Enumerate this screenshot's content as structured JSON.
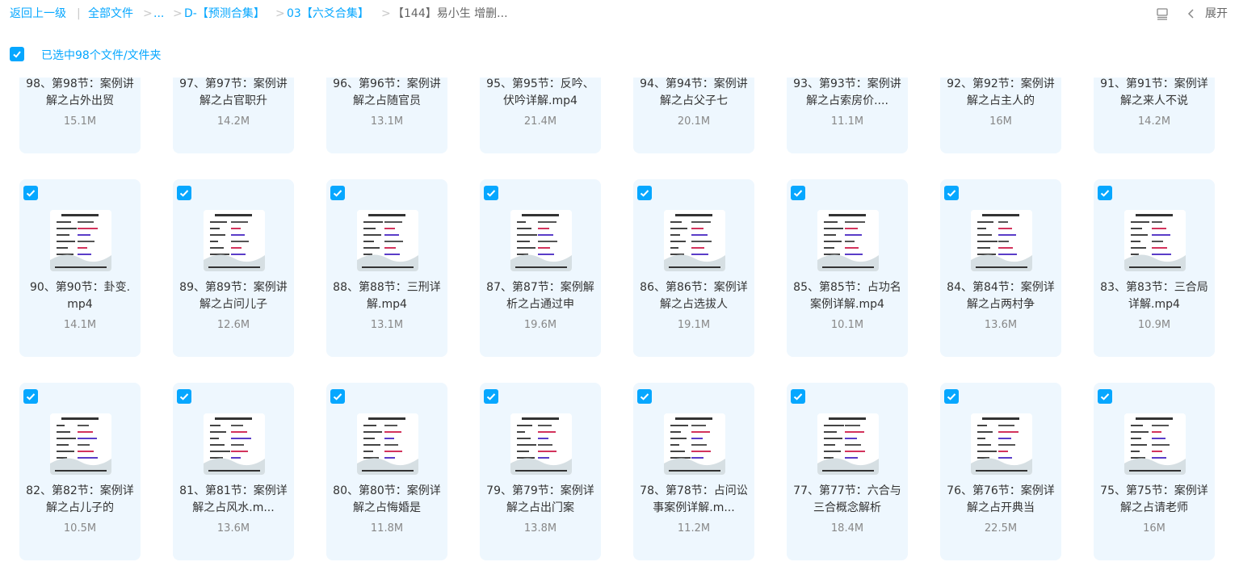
{
  "breadcrumb": {
    "back": "返回上一级",
    "all_files": "全部文件",
    "ellipsis": "...",
    "folder1": "D-【预测合集】",
    "folder2": "03【六爻合集】",
    "current": "【144】易小生 增删..."
  },
  "toolbar": {
    "expand_label": "展开"
  },
  "selection": {
    "text": "已选中98个文件/文件夹"
  },
  "files": [
    {
      "name": "98、第98节：案例讲解之占外出贸",
      "size": "15.1M"
    },
    {
      "name": "97、第97节：案例讲解之占官职升",
      "size": "14.2M"
    },
    {
      "name": "96、第96节：案例讲解之占随官员",
      "size": "13.1M"
    },
    {
      "name": "95、第95节：反吟、伏吟详解.mp4",
      "size": "21.4M"
    },
    {
      "name": "94、第94节：案例讲解之占父子七",
      "size": "20.1M"
    },
    {
      "name": "93、第93节：案例讲解之占索房价....",
      "size": "11.1M"
    },
    {
      "name": "92、第92节：案例讲解之占主人的",
      "size": "16M"
    },
    {
      "name": "91、第91节：案例详解之来人不说",
      "size": "14.2M"
    },
    {
      "name": "90、第90节：卦变.mp4",
      "size": "14.1M"
    },
    {
      "name": "89、第89节：案例讲解之占问儿子",
      "size": "12.6M"
    },
    {
      "name": "88、第88节：三刑详解.mp4",
      "size": "13.1M"
    },
    {
      "name": "87、第87节：案例解析之占通过申",
      "size": "19.6M"
    },
    {
      "name": "86、第86节：案例详解之占选拔人",
      "size": "19.1M"
    },
    {
      "name": "85、第85节：占功名案例详解.mp4",
      "size": "10.1M"
    },
    {
      "name": "84、第84节：案例详解之占两村争",
      "size": "13.6M"
    },
    {
      "name": "83、第83节：三合局详解.mp4",
      "size": "10.9M"
    },
    {
      "name": "82、第82节：案例详解之占儿子的",
      "size": "10.5M"
    },
    {
      "name": "81、第81节：案例详解之占风水.m...",
      "size": "13.6M"
    },
    {
      "name": "80、第80节：案例详解之占悔婚是",
      "size": "11.8M"
    },
    {
      "name": "79、第79节：案例详解之占出门案",
      "size": "13.8M"
    },
    {
      "name": "78、第78节：占问讼事案例详解.m...",
      "size": "11.2M"
    },
    {
      "name": "77、第77节：六合与三合概念解析",
      "size": "18.4M"
    },
    {
      "name": "76、第76节：案例详解之占开典当",
      "size": "22.5M"
    },
    {
      "name": "75、第75节：案例详解之占请老师",
      "size": "16M"
    }
  ],
  "colors": {
    "accent": "#06a7ff",
    "card_bg": "#eef7fe"
  },
  "icons": {
    "checkbox": "checkmark-icon",
    "view_toggle": "list-view-icon",
    "collapse": "chevron-left-icon"
  }
}
